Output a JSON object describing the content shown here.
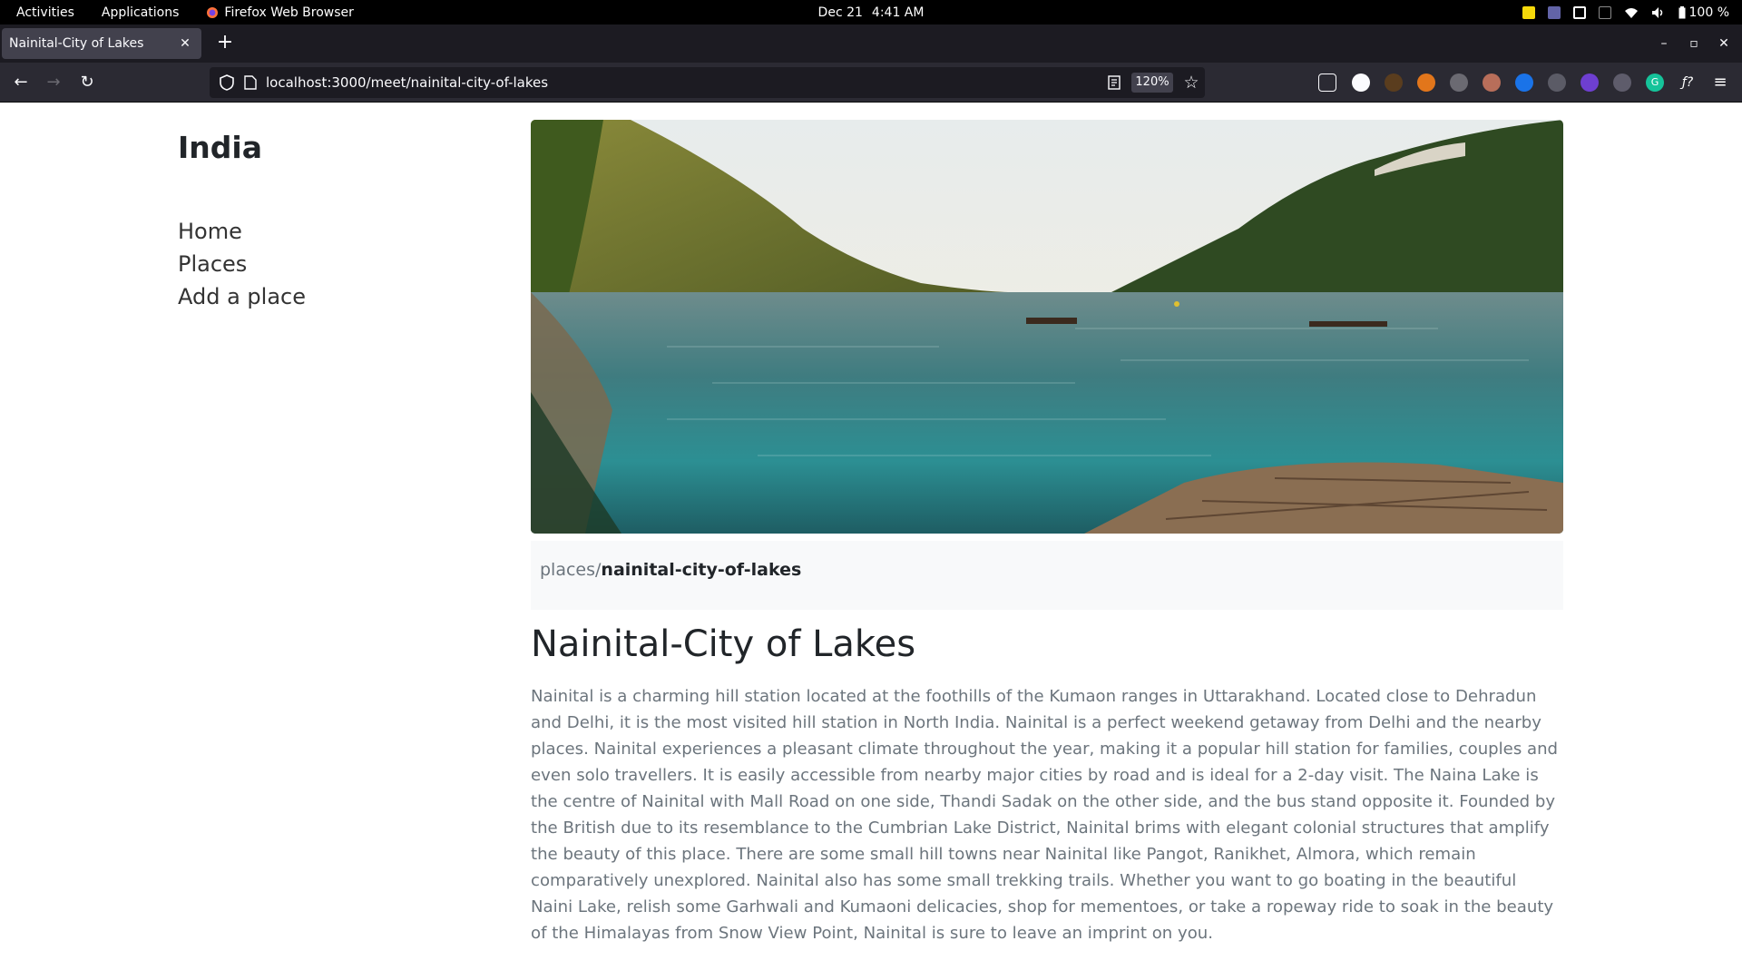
{
  "system_bar": {
    "activities": "Activities",
    "applications": "Applications",
    "app_name": "Firefox Web Browser",
    "date": "Dec 21",
    "time": "4:41 AM",
    "battery": "100 %"
  },
  "browser": {
    "tab_title": "Nainital-City of Lakes",
    "url": "localhost:3000/meet/nainital-city-of-lakes",
    "zoom": "120%"
  },
  "site": {
    "brand": "India",
    "nav": [
      "Home",
      "Places",
      "Add a place"
    ]
  },
  "article": {
    "breadcrumb_parent": "places/",
    "breadcrumb_current": "nainital-city-of-lakes",
    "title": "Nainital-City of Lakes",
    "description": "Nainital is a charming hill station located at the foothills of the Kumaon ranges in Uttarakhand. Located close to Dehradun and Delhi, it is the most visited hill station in North India. Nainital is a perfect weekend getaway from Delhi and the nearby places. Nainital experiences a pleasant climate throughout the year, making it a popular hill station for families, couples and even solo travellers. It is easily accessible from nearby major cities by road and is ideal for a 2-day visit. The Naina Lake is the centre of Nainital with Mall Road on one side, Thandi Sadak on the other side, and the bus stand opposite it. Founded by the British due to its resemblance to the Cumbrian Lake District, Nainital brims with elegant colonial structures that amplify the beauty of this place. There are some small hill towns near Nainital like Pangot, Ranikhet, Almora, which remain comparatively unexplored. Nainital also has some small trekking trails. Whether you want to go boating in the beautiful Naini Lake, relish some Garhwali and Kumaoni delicacies, shop for mementoes, or take a ropeway ride to soak in the beauty of the Himalayas from Snow View Point, Nainital is sure to leave an imprint on you."
  },
  "colors": {
    "topbar": "#000000",
    "tabstrip": "#1c1b22",
    "toolbar": "#2b2a33",
    "breadcrumb_bg": "#f8f9fa",
    "text_muted": "#6c757d",
    "text_dark": "#212529"
  }
}
